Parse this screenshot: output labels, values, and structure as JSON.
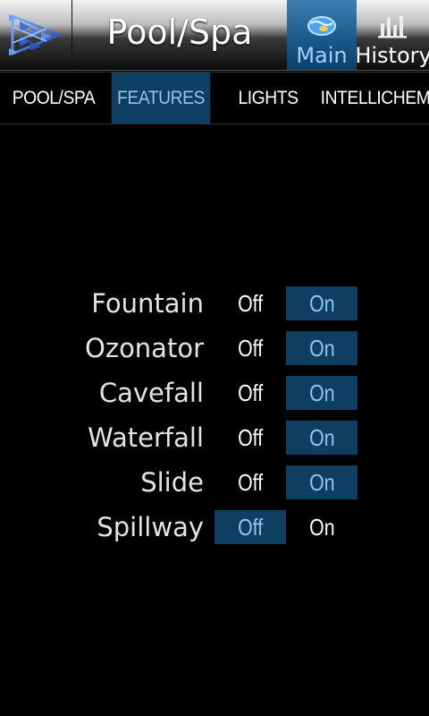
{
  "header": {
    "title": "Pool/Spa",
    "nav": {
      "main_label": "Main",
      "history_label": "History"
    }
  },
  "tabs": [
    {
      "label": "POOL/SPA",
      "active": false
    },
    {
      "label": "FEATURES",
      "active": true
    },
    {
      "label": "LIGHTS",
      "active": false
    },
    {
      "label": "INTELLICHEM",
      "active": false
    }
  ],
  "features": [
    {
      "name": "Fountain",
      "off_label": "Off",
      "on_label": "On",
      "state": "on"
    },
    {
      "name": "Ozonator",
      "off_label": "Off",
      "on_label": "On",
      "state": "on"
    },
    {
      "name": "Cavefall",
      "off_label": "Off",
      "on_label": "On",
      "state": "on"
    },
    {
      "name": "Waterfall",
      "off_label": "Off",
      "on_label": "On",
      "state": "on"
    },
    {
      "name": "Slide",
      "off_label": "Off",
      "on_label": "On",
      "state": "on"
    },
    {
      "name": "Spillway",
      "off_label": "Off",
      "on_label": "On",
      "state": "off"
    }
  ],
  "colors": {
    "accent": "#0e3f62",
    "accent_text": "#8fc6ef"
  },
  "icons": {
    "logo": "app-logo",
    "main": "pool-water-icon",
    "history": "bar-chart-icon"
  }
}
